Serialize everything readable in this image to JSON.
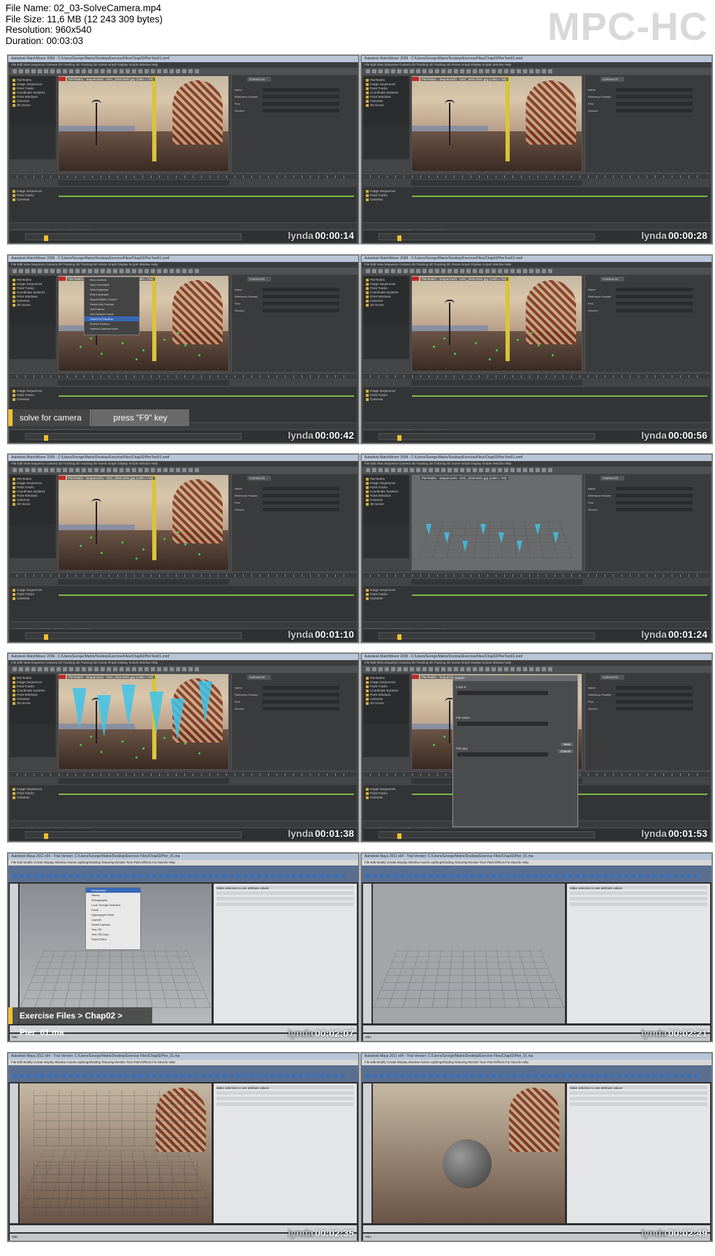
{
  "file_info": {
    "file_name": "File Name: 02_03-SolveCamera.mp4",
    "file_size": "File Size: 11,6 MB (12 243 309 bytes)",
    "resolution": "Resolution: 960x540",
    "duration": "Duration: 00:03:03"
  },
  "player_logo": "MPC-HC",
  "watermark": "lynda",
  "matchmover": {
    "window_title": "Autodesk MatchMover 2009 - C:/Users/George/Matrix/Desktop/Exercise/Files/Chap02/PierTest01.mmf",
    "menu": "File  Edit  View  Sequence  Camera  2D Tracking  3D Tracking  3D Scene  Graph  Display  Scripts  Window  Help",
    "viewport_info": "PierTest01 - Sequence01 - DSC_0018.0001.jpg (1280 x 720)",
    "tree_items": [
      "PierTest01",
      "Image Sequences",
      "Point Tracks",
      "Coordinate Systems",
      "Point Windows",
      "Cameras",
      "3D Scene"
    ],
    "lower_tree": [
      "Image Sequences",
      "Point Tracks",
      "Cameras"
    ],
    "attr_tab": "Camera 01",
    "attr_rows": [
      "Name",
      "Reference Frames",
      "First",
      "Second"
    ],
    "tabs": [
      "Track View",
      "Graph Editor",
      "Track Status"
    ]
  },
  "menu_popup": [
    "New Camera",
    "New Constraint",
    "New Keyframe",
    "Edit Constraint",
    "Import Motion Control",
    "Select Key Frames",
    "Set Frames",
    "Set Camera Frame",
    "Solve For Camera",
    "Extend Camera",
    "Refined Camera Solve"
  ],
  "dialog": {
    "title": "Export",
    "fields": [
      "Look in",
      "File name",
      "File type"
    ],
    "buttons": [
      "Save",
      "Cancel"
    ]
  },
  "maya": {
    "window_title": "Autodesk Maya 2011 x64 - Trial Version: C:/Users/George/Matrix/Desktop/Exercise Files/Chap02/Pier_01.ma",
    "menu": "File  Edit  Modify  Create  Display  Window  Assets  Lighting/Shading  Texturing  Render  Toon  Paint Effects  Fur  Muscle  Help",
    "attr_text": "Make selection to see attribute values",
    "cmd": "MEL",
    "panel_tab": "Perspective",
    "panel_menu": [
      "Perspective",
      "Stereo",
      "Orthographic",
      "Look Through Selected",
      "Panel",
      "Hypergraph Panel",
      "Layouts",
      "Saved Layouts",
      "Tear Off",
      "Tear Off Copy",
      "Panel Editor"
    ]
  },
  "frames": [
    {
      "timestamp": "00:00:14",
      "kind": "mm-plain"
    },
    {
      "timestamp": "00:00:28",
      "kind": "mm-plain"
    },
    {
      "timestamp": "00:00:42",
      "kind": "mm-menu",
      "caption_left": "solve for camera",
      "caption_right": "press \"F9\" key"
    },
    {
      "timestamp": "00:00:56",
      "kind": "mm-solved"
    },
    {
      "timestamp": "00:01:10",
      "kind": "mm-solved"
    },
    {
      "timestamp": "00:01:24",
      "kind": "mm-3d"
    },
    {
      "timestamp": "00:01:38",
      "kind": "mm-cones"
    },
    {
      "timestamp": "00:01:53",
      "kind": "mm-dialog"
    },
    {
      "timestamp": "00:02:07",
      "kind": "maya-menu",
      "caption_single": "Exercise Files > Chap02 > Pier_01.ma"
    },
    {
      "timestamp": "00:02:21",
      "kind": "maya-flat"
    },
    {
      "timestamp": "00:02:35",
      "kind": "maya-quad"
    },
    {
      "timestamp": "00:02:49",
      "kind": "maya-sphere"
    }
  ],
  "colors": {
    "caption_accent": "#f0c030",
    "track_point": "#3fd43f",
    "cone": "#3ec3e8"
  }
}
